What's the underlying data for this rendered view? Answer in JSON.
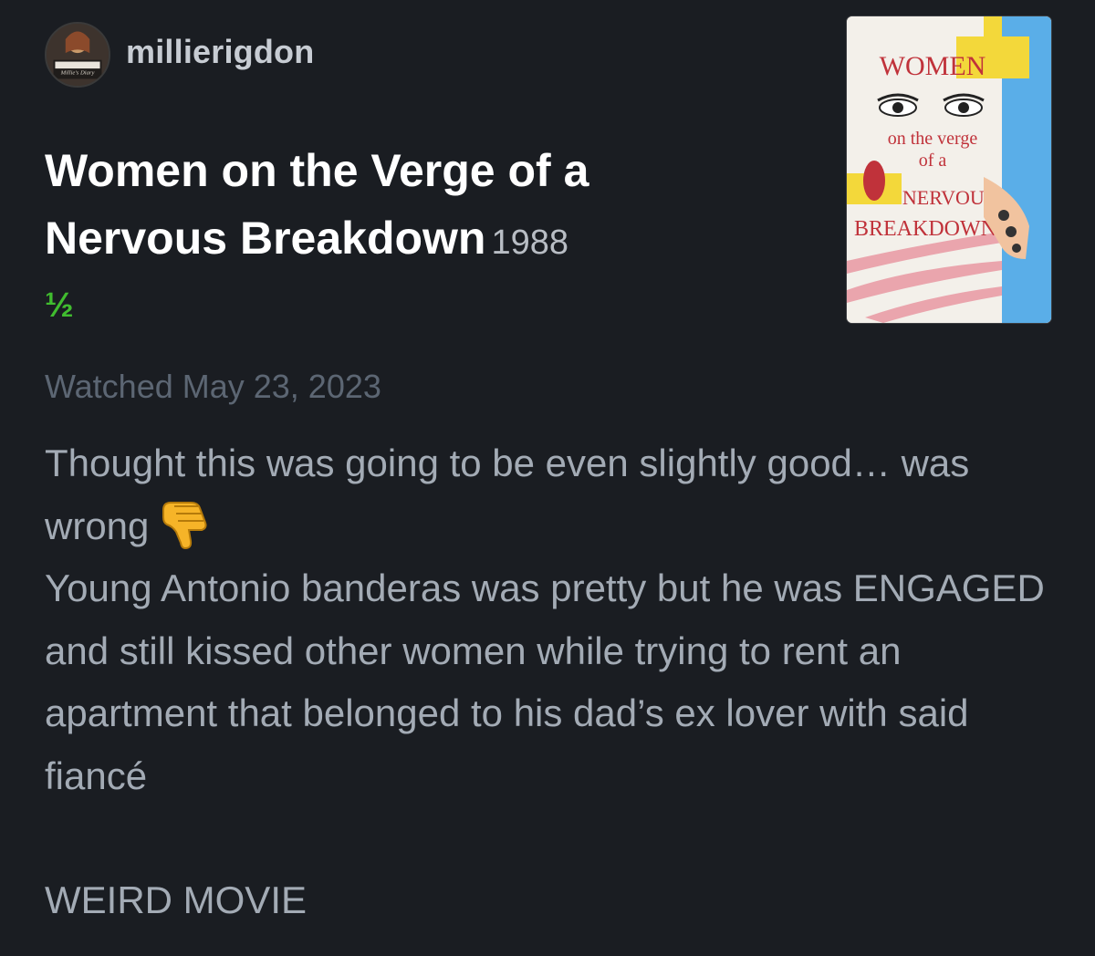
{
  "user": {
    "username": "millierigdon",
    "avatar_text": "Millie's Diary"
  },
  "film": {
    "title": "Women on the Verge of a Nervous Breakdown",
    "year": "1988",
    "rating": "½"
  },
  "entry": {
    "watched": "Watched May 23, 2023",
    "review_line1": "Thought this was going to be even slightly good… was wrong",
    "review_line2": "Young Antonio banderas was pretty but he was ENGAGED and still kissed other women while trying to rent an apartment that belonged to his dad’s ex lover with said fiancé",
    "footer": "WEIRD MOVIE",
    "emoji_icon": "thumbs-down-icon"
  },
  "poster": {
    "title_word1": "WOMEN",
    "subtitle1": "on the verge",
    "subtitle2": "of a",
    "title_word2": "NERVOUS",
    "title_word3": "BREAKDOWN"
  },
  "colors": {
    "background": "#1a1d22",
    "rating_green": "#40bc2f",
    "review_text": "#a3abb5",
    "muted": "#5c6673"
  }
}
